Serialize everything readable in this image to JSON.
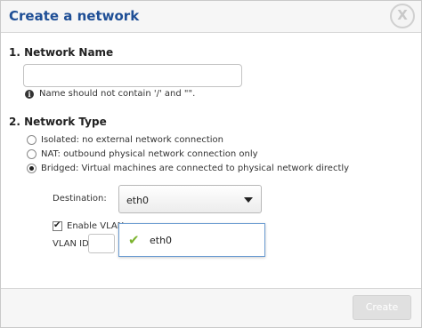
{
  "dialog": {
    "title": "Create a network",
    "close_icon": "X"
  },
  "network_name": {
    "section_title": "1. Network Name",
    "value": "",
    "hint": "Name should not contain '/' and \"\"."
  },
  "network_type": {
    "section_title": "2. Network Type",
    "options": [
      {
        "label": "Isolated: no external network connection",
        "selected": false
      },
      {
        "label": "NAT: outbound physical network connection only",
        "selected": false
      },
      {
        "label": "Bridged: Virtual machines are connected to physical network directly",
        "selected": true
      }
    ],
    "destination_label": "Destination:",
    "destination_value": "eth0",
    "dropdown_options": [
      "eth0"
    ],
    "vlan_label": "Enable VLAN",
    "vlan_checked": true,
    "vlan_id_label": "VLAN ID:"
  },
  "footer": {
    "create_label": "Create"
  },
  "colors": {
    "title": "#1f4f96",
    "check": "#7bb32e",
    "dropdown_border": "#6a9bd1"
  }
}
